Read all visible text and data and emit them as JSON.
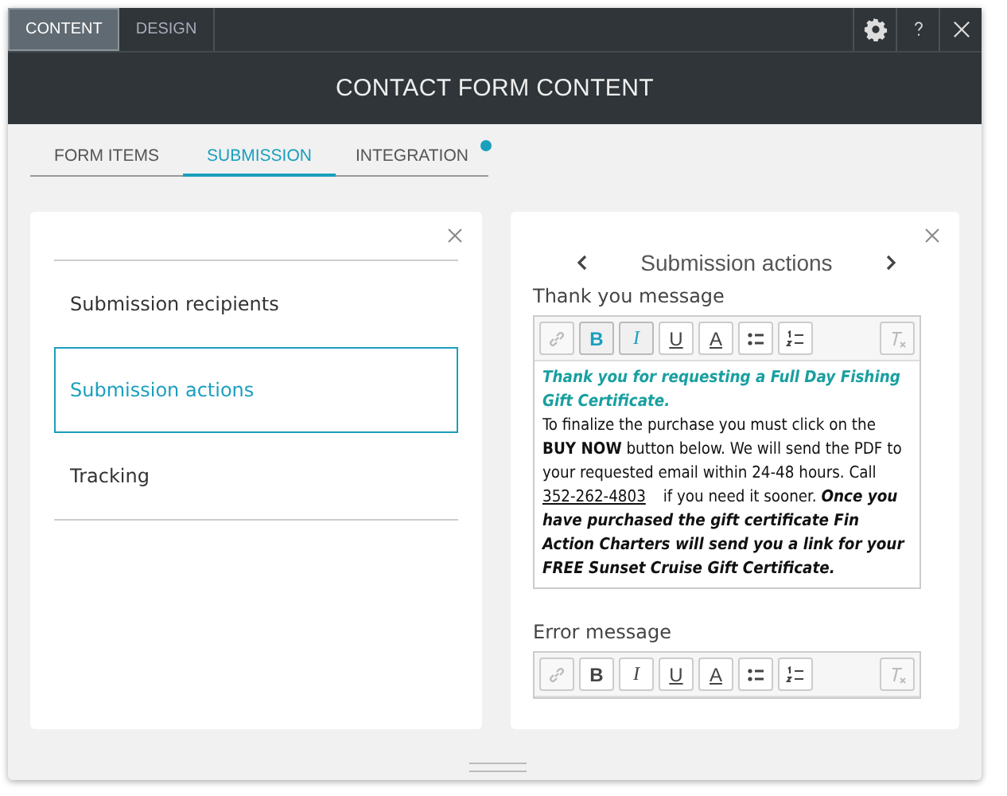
{
  "top_tabs": [
    {
      "label": "CONTENT",
      "selected": true
    },
    {
      "label": "DESIGN",
      "selected": false
    }
  ],
  "title": "CONTACT FORM CONTENT",
  "tabs": [
    {
      "label": "FORM ITEMS",
      "selected": false,
      "badge": false
    },
    {
      "label": "SUBMISSION",
      "selected": true,
      "badge": false
    },
    {
      "label": "INTEGRATION",
      "selected": false,
      "badge": true
    }
  ],
  "menu": [
    {
      "label": "Submission recipients",
      "selected": false
    },
    {
      "label": "Submission actions",
      "selected": true
    },
    {
      "label": "Tracking",
      "selected": false
    }
  ],
  "detail": {
    "heading": "Submission actions",
    "editors": [
      {
        "label": "Thank you message",
        "toolbar": [
          {
            "kind": "link",
            "active": false,
            "disabled": true
          },
          {
            "kind": "bold",
            "label": "B",
            "active": true,
            "disabled": false
          },
          {
            "kind": "italic",
            "label": "I",
            "active": true,
            "disabled": false
          },
          {
            "kind": "underline",
            "label": "U",
            "active": false,
            "disabled": false
          },
          {
            "kind": "color",
            "label": "A",
            "active": false,
            "disabled": false
          },
          {
            "kind": "bullets",
            "active": false,
            "disabled": false
          },
          {
            "kind": "numbers",
            "active": false,
            "disabled": false
          },
          {
            "kind": "clear",
            "active": false,
            "disabled": true
          }
        ],
        "content": {
          "headline": "Thank you for requesting a Full Day Fishing Gift Certificate.",
          "before": "To finalize the purchase you must click on the **BUY NOW** button below. We will send the PDF to your requested email within 24-48 hours. Call ",
          "link": "352-262-4803",
          "after": " if you need it sooner. *Once you have purchased the gift certificate Fin Action Charters will send you a link for your FREE Sunset Cruise Gift Certificate.*"
        }
      },
      {
        "label": "Error message",
        "toolbar": [
          {
            "kind": "link",
            "active": false,
            "disabled": true
          },
          {
            "kind": "bold",
            "label": "B",
            "active": false,
            "disabled": false
          },
          {
            "kind": "italic",
            "label": "I",
            "active": false,
            "disabled": false
          },
          {
            "kind": "underline",
            "label": "U",
            "active": false,
            "disabled": false
          },
          {
            "kind": "color",
            "label": "A",
            "active": false,
            "disabled": false
          },
          {
            "kind": "bullets",
            "active": false,
            "disabled": false
          },
          {
            "kind": "numbers",
            "active": false,
            "disabled": false
          },
          {
            "kind": "clear",
            "active": false,
            "disabled": true
          }
        ]
      }
    ]
  }
}
